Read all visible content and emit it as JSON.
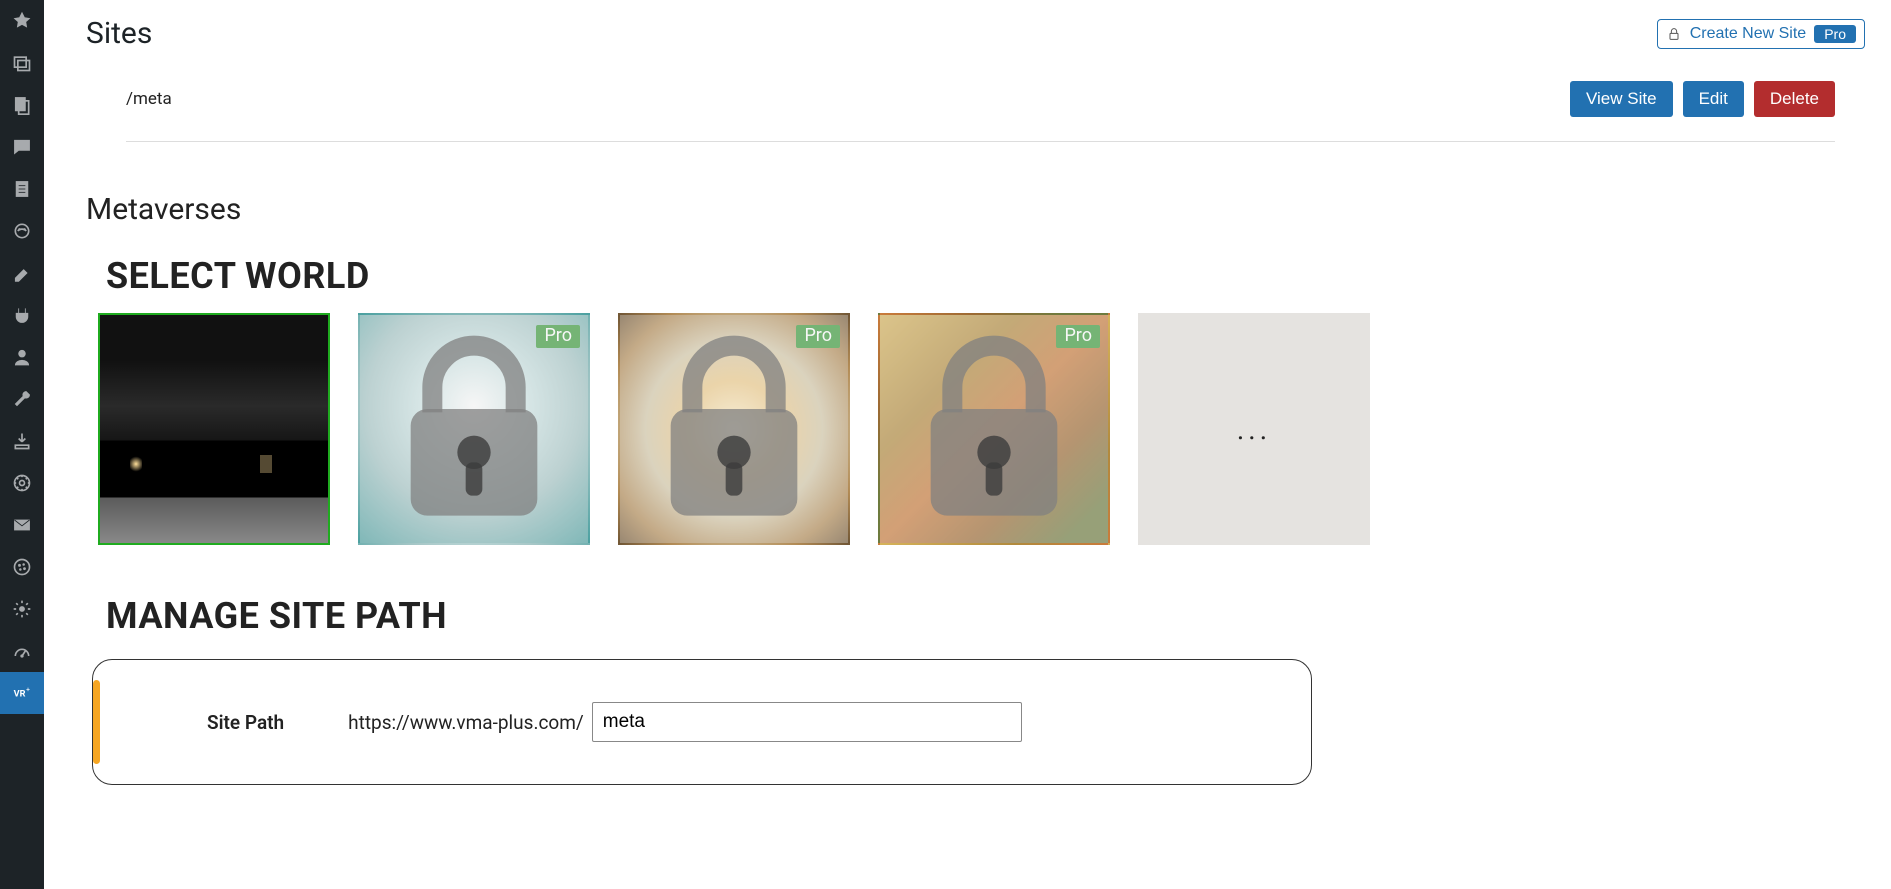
{
  "header": {
    "sites_title": "Sites",
    "create_label": "Create New Site",
    "create_pro": "Pro"
  },
  "site_entry": {
    "path": "/meta",
    "view_label": "View Site",
    "edit_label": "Edit",
    "delete_label": "Delete"
  },
  "metaverses": {
    "title": "Metaverses",
    "select_world": "SELECT WORLD",
    "pro_badge": "Pro",
    "more": "..."
  },
  "manage": {
    "title": "MANAGE SITE PATH",
    "label": "Site Path",
    "url_prefix": "https://www.vma-plus.com/",
    "value": "meta"
  }
}
